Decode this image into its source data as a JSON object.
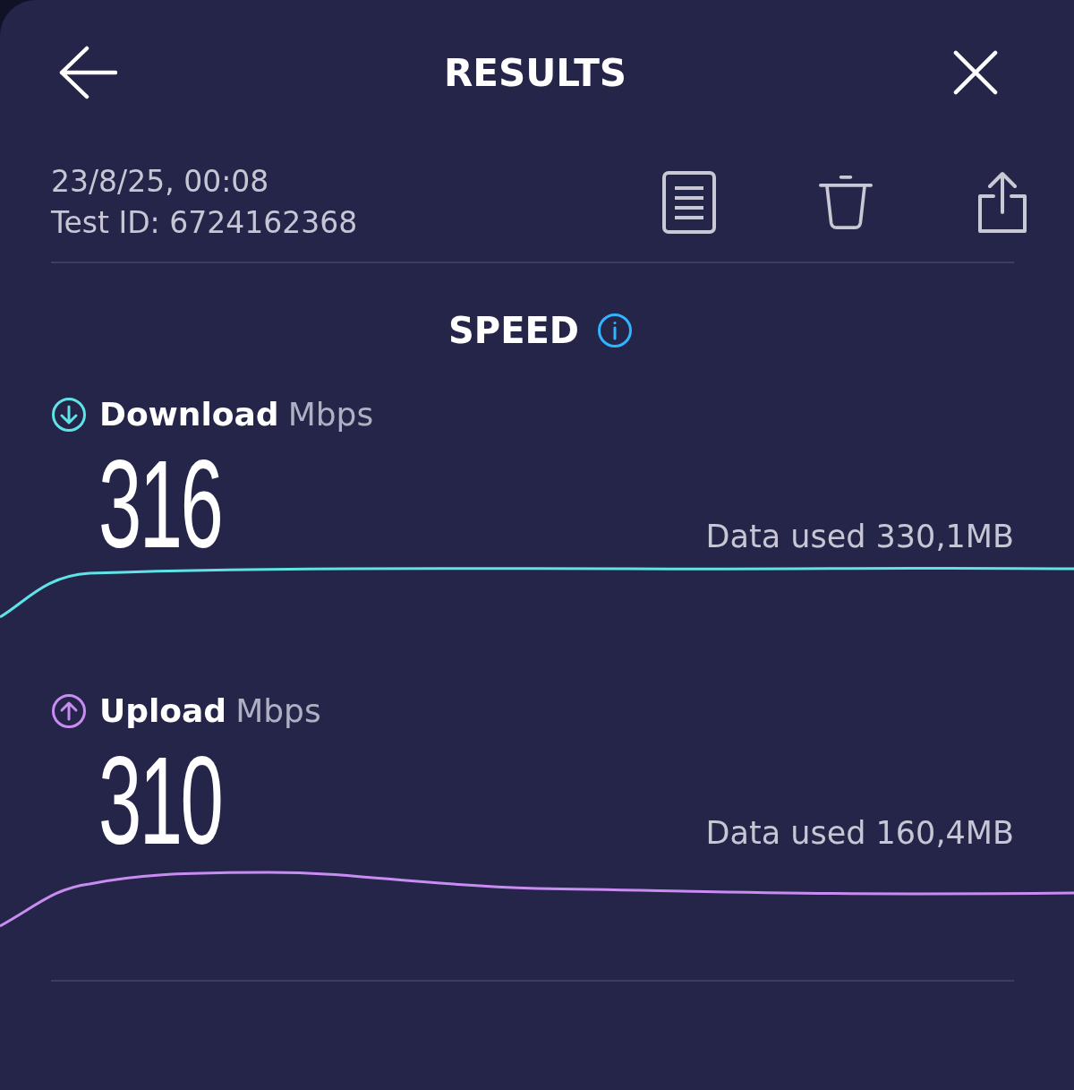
{
  "header": {
    "title": "RESULTS"
  },
  "test": {
    "date": "23/8/25, 00:08",
    "test_id": "Test ID: 6724162368"
  },
  "speed": {
    "title": "SPEED"
  },
  "metrics": [
    {
      "kind": "download",
      "label": "Download",
      "unit": "Mbps",
      "value": "316",
      "data_used": "Data used 330,1MB",
      "color": "#5fe3e6"
    },
    {
      "kind": "upload",
      "label": "Upload",
      "unit": "Mbps",
      "value": "310",
      "data_used": "Data used 160,4MB",
      "color": "#c88cf2"
    }
  ]
}
